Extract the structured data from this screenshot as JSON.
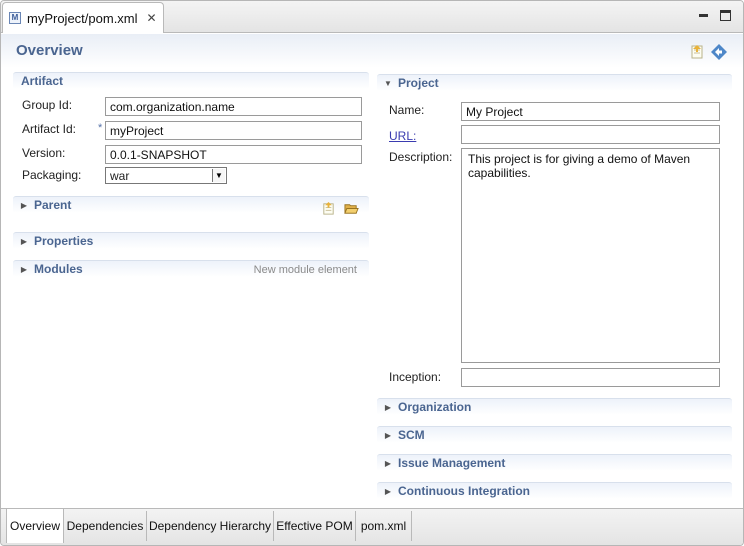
{
  "editor_tab": {
    "title": "myProject/pom.xml",
    "icon": "maven-file-icon"
  },
  "header": {
    "title": "Overview"
  },
  "artifact": {
    "section_label": "Artifact",
    "group_id_label": "Group Id:",
    "group_id_value": "com.organization.name",
    "artifact_id_label": "Artifact Id:",
    "artifact_id_required": "*",
    "artifact_id_value": "myProject",
    "version_label": "Version:",
    "version_value": "0.0.1-SNAPSHOT",
    "packaging_label": "Packaging:",
    "packaging_value": "war"
  },
  "left_sections": {
    "parent": "Parent",
    "properties": "Properties",
    "modules": "Modules",
    "modules_action": "New module element"
  },
  "project": {
    "section_label": "Project",
    "name_label": "Name:",
    "name_value": "My Project",
    "url_label": "URL:",
    "url_value": "",
    "description_label": "Description:",
    "description_value": "This project is for giving a demo of Maven capabilities.",
    "inception_label": "Inception:",
    "inception_value": ""
  },
  "right_sections": {
    "organization": "Organization",
    "scm": "SCM",
    "issue_management": "Issue Management",
    "continuous_integration": "Continuous Integration"
  },
  "bottom_tabs": [
    "Overview",
    "Dependencies",
    "Dependency Hierarchy",
    "Effective POM",
    "pom.xml"
  ],
  "colors": {
    "section_title": "#4a6590",
    "link": "#3a3bb0",
    "header_title": "#4a6590"
  }
}
